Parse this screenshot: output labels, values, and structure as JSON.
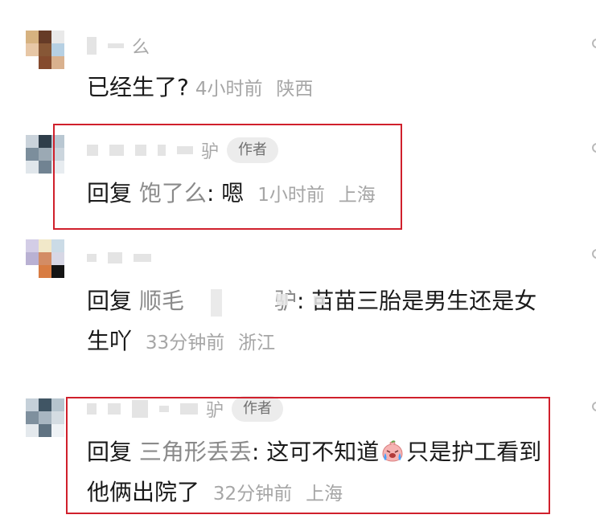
{
  "comments": [
    {
      "name_suffix": "么",
      "text": "已经生了?",
      "time": "4小时前",
      "location": "陕西"
    },
    {
      "name_suffix": "驴",
      "badge": "作者",
      "reply_word": "回复",
      "reply_target": "饱了么",
      "text": "嗯",
      "time": "1小时前",
      "location": "上海"
    },
    {
      "name_suffix": "",
      "reply_word": "回复",
      "reply_target": "顺毛",
      "reply_target_suffix": "驴",
      "text": "苗苗三胎是男生还是女生吖",
      "time": "33分钟前",
      "location": "浙江"
    },
    {
      "name_suffix": "驴",
      "badge": "作者",
      "reply_word": "回复",
      "reply_target": "三角形丢丢",
      "text_before_emoji": "这可不知道",
      "emoji": "crying-face-emoji",
      "text_after_emoji": "只是护工看到他俩出院了",
      "time": "32分钟前",
      "location": "上海"
    }
  ],
  "colors": {
    "highlight": "#d0202c",
    "meta": "#a6a6a6",
    "reply_target": "#8a8a8a"
  }
}
